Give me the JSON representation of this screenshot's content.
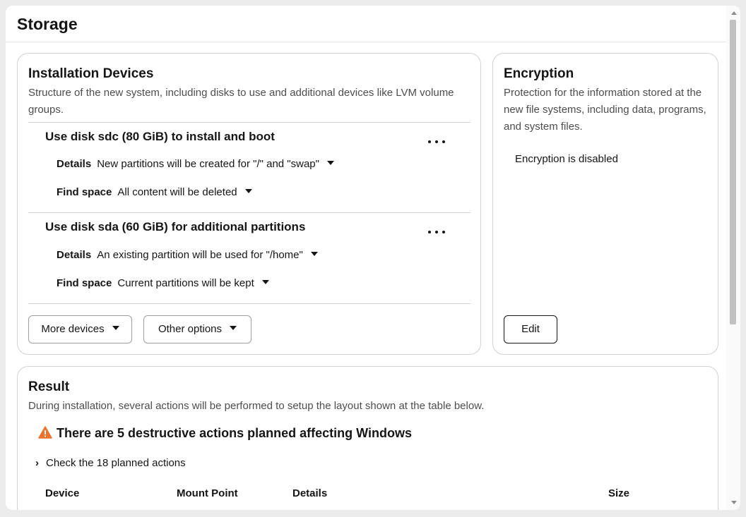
{
  "page": {
    "title": "Storage"
  },
  "installation_devices": {
    "title": "Installation Devices",
    "description": "Structure of the new system, including disks to use and additional devices like LVM volume groups.",
    "devices": [
      {
        "title": "Use disk sdc (80 GiB) to install and boot",
        "details_label": "Details",
        "details_value": "New partitions will be created for \"/\" and \"swap\"",
        "find_space_label": "Find space",
        "find_space_value": "All content will be deleted"
      },
      {
        "title": "Use disk sda (60 GiB) for additional partitions",
        "details_label": "Details",
        "details_value": "An existing partition will be used for \"/home\"",
        "find_space_label": "Find space",
        "find_space_value": "Current partitions will be kept"
      }
    ],
    "more_devices_label": "More devices",
    "other_options_label": "Other options"
  },
  "encryption": {
    "title": "Encryption",
    "description": "Protection for the information stored at the new file systems, including data, programs, and system files.",
    "status": "Encryption is disabled",
    "edit_label": "Edit"
  },
  "result": {
    "title": "Result",
    "description": "During installation, several actions will be performed to setup the layout shown at the table below.",
    "warning": "There are 5 destructive actions planned affecting Windows",
    "expand_label": "Check the 18 planned actions",
    "columns": [
      "Device",
      "Mount Point",
      "Details",
      "Size"
    ]
  },
  "colors": {
    "warning": "#f0712c",
    "border": "#d2d2d2",
    "text": "#151515"
  },
  "icons": {
    "menu": "kebab-icon",
    "dropdown": "caret-down-icon",
    "warning": "warning-triangle-icon",
    "expand": "chevron-right-icon"
  }
}
